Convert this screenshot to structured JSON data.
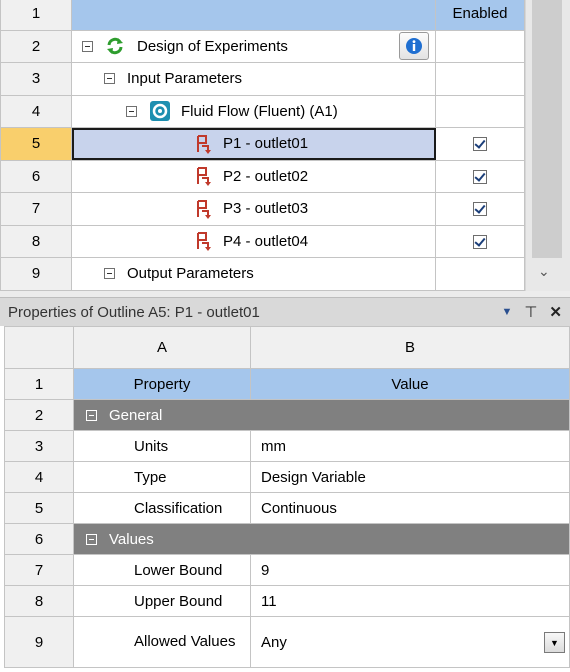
{
  "outline": {
    "header_enabled": "Enabled",
    "rows": [
      {
        "num": "1"
      },
      {
        "num": "2",
        "label": "Design of Experiments"
      },
      {
        "num": "3",
        "label": "Input Parameters"
      },
      {
        "num": "4",
        "label": "Fluid Flow (Fluent) (A1)"
      },
      {
        "num": "5",
        "label": "P1 - outlet01",
        "enabled": true
      },
      {
        "num": "6",
        "label": "P2 - outlet02",
        "enabled": true
      },
      {
        "num": "7",
        "label": "P3 - outlet03",
        "enabled": true
      },
      {
        "num": "8",
        "label": "P4 - outlet04",
        "enabled": true
      },
      {
        "num": "9",
        "label": "Output Parameters"
      }
    ]
  },
  "properties": {
    "title": "Properties of Outline A5: P1 - outlet01",
    "col_a": "A",
    "col_b": "B",
    "header_property": "Property",
    "header_value": "Value",
    "rows": [
      {
        "num": "1"
      },
      {
        "num": "2",
        "group": "General"
      },
      {
        "num": "3",
        "property": "Units",
        "value": "mm"
      },
      {
        "num": "4",
        "property": "Type",
        "value": "Design Variable"
      },
      {
        "num": "5",
        "property": "Classification",
        "value": "Continuous"
      },
      {
        "num": "6",
        "group": "Values"
      },
      {
        "num": "7",
        "property": "Lower Bound",
        "value": "9"
      },
      {
        "num": "8",
        "property": "Upper Bound",
        "value": "11"
      },
      {
        "num": "9",
        "property": "Allowed Values",
        "value": "Any"
      }
    ]
  },
  "colors": {
    "header_blue": "#a5c6ec",
    "selected_row_number": "#f9cf6c",
    "group_gray": "#808080",
    "parameter_icon": "#c0392b"
  }
}
